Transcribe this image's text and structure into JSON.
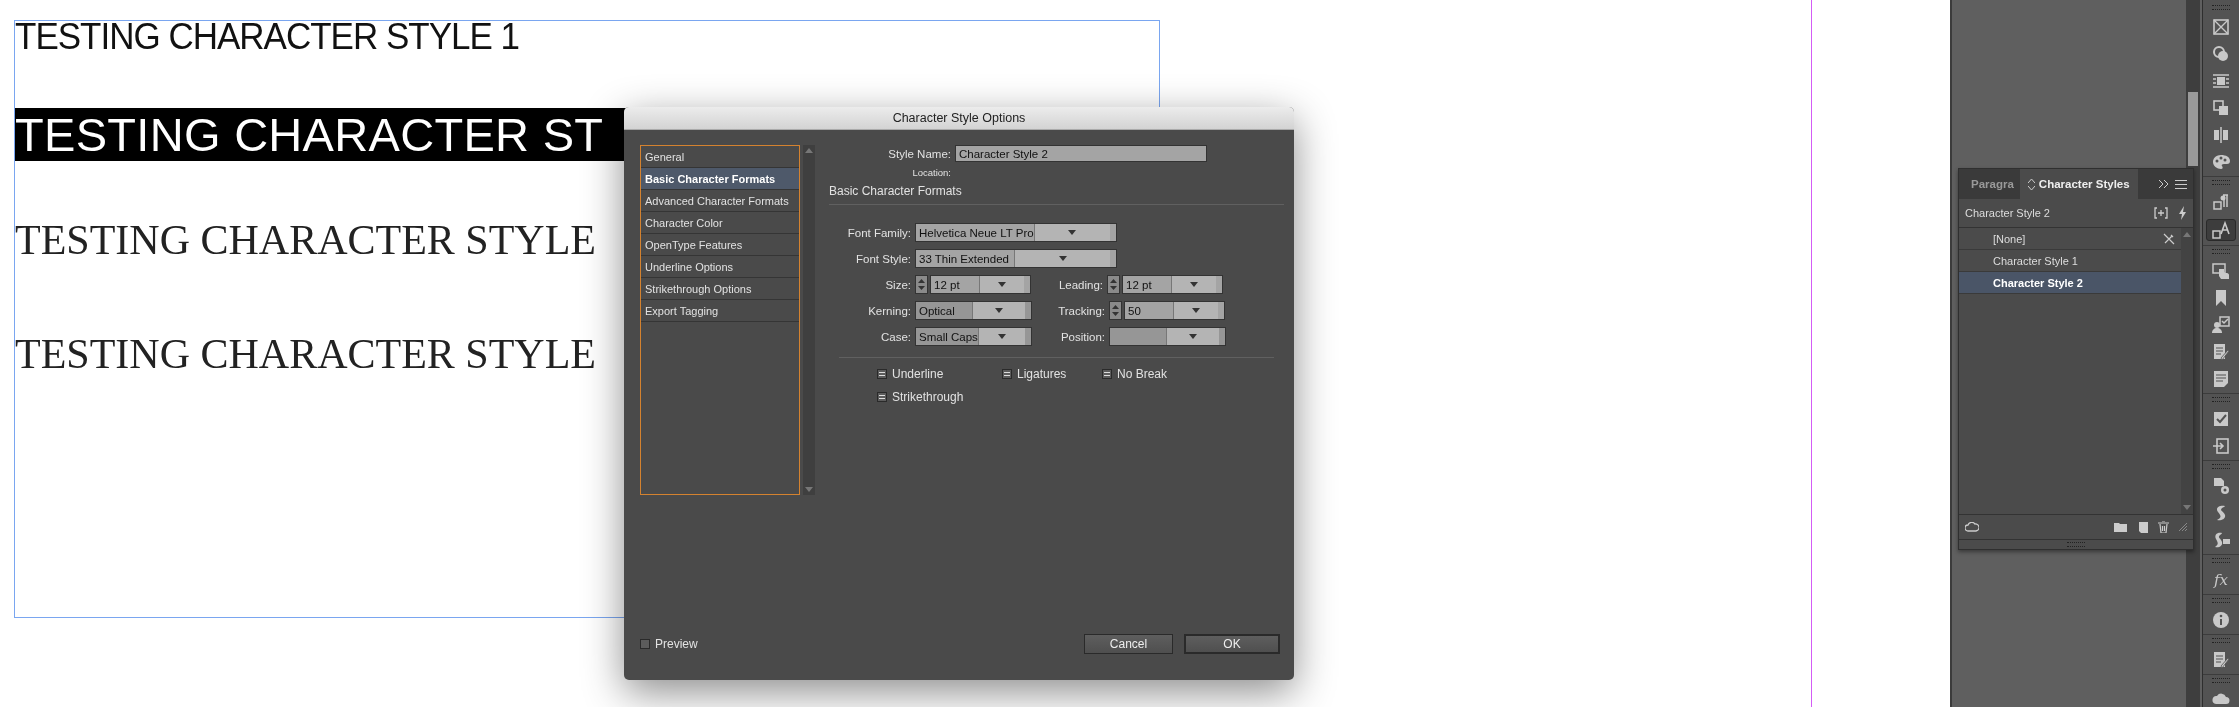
{
  "canvas": {
    "lines": [
      {
        "text": "TESTING CHARACTER STYLE 1",
        "kind": "thin"
      },
      {
        "text": "TESTING CHARACTER ST",
        "kind": "inverse"
      },
      {
        "text": "TESTING CHARACTER STYLE",
        "kind": "serif"
      },
      {
        "text": "TESTING CHARACTER STYLE",
        "kind": "serif"
      }
    ]
  },
  "dialog": {
    "title": "Character Style Options",
    "categories": [
      {
        "label": "General",
        "selected": false
      },
      {
        "label": "Basic Character Formats",
        "selected": true
      },
      {
        "label": "Advanced Character Formats",
        "selected": false
      },
      {
        "label": "Character Color",
        "selected": false
      },
      {
        "label": "OpenType Features",
        "selected": false
      },
      {
        "label": "Underline Options",
        "selected": false
      },
      {
        "label": "Strikethrough Options",
        "selected": false
      },
      {
        "label": "Export Tagging",
        "selected": false
      }
    ],
    "style_name": {
      "label": "Style Name:",
      "value": "Character Style 2"
    },
    "location_label": "Location:",
    "section_title": "Basic Character Formats",
    "fields": [
      [
        {
          "label": "Font Family:",
          "value": "Helvetica Neue LT Pro",
          "kind": "combo"
        }
      ],
      [
        {
          "label": "Font Style:",
          "value": "33 Thin Extended",
          "kind": "combo"
        }
      ],
      [
        {
          "label": "Size:",
          "value": "12 pt",
          "kind": "spin"
        },
        {
          "label": "Leading:",
          "value": "12 pt",
          "kind": "spin"
        }
      ],
      [
        {
          "label": "Kerning:",
          "value": "Optical",
          "kind": "select"
        },
        {
          "label": "Tracking:",
          "value": "50",
          "kind": "spin"
        }
      ],
      [
        {
          "label": "Case:",
          "value": "Small Caps",
          "kind": "select"
        },
        {
          "label": "Position:",
          "kind": "select"
        }
      ]
    ],
    "options": [
      [
        {
          "label": "Underline",
          "ignored": true
        },
        {
          "label": "Ligatures",
          "ignored": true
        },
        {
          "label": "No Break",
          "ignored": true
        }
      ],
      [
        {
          "label": "Strikethrough",
          "ignored": true
        }
      ]
    ],
    "preview": {
      "label": "Preview",
      "checked": false
    },
    "buttons": [
      {
        "label": "Cancel",
        "kind": "normal"
      },
      {
        "label": "OK",
        "kind": "default"
      }
    ]
  },
  "panel": {
    "tabs": [
      {
        "label": "Paragra",
        "selected": false
      },
      {
        "label": "Character Styles",
        "selected": true
      }
    ],
    "current_style": "Character Style 2",
    "styles": [
      {
        "name": "[None]",
        "selected": false,
        "locked": true
      },
      {
        "name": "Character Style 1",
        "selected": false,
        "locked": false
      },
      {
        "name": "Character Style 2",
        "selected": true,
        "locked": false
      }
    ]
  },
  "toolbar": [
    [
      {
        "kind": "frame",
        "selected": false
      },
      {
        "kind": "circles",
        "selected": false
      },
      {
        "kind": "wrap",
        "selected": false
      },
      {
        "kind": "layers",
        "selected": false
      },
      {
        "kind": "align",
        "selected": false
      },
      {
        "kind": "palette",
        "selected": false
      }
    ],
    [
      {
        "kind": "paragraph",
        "selected": false
      },
      {
        "kind": "character",
        "selected": true
      }
    ],
    [
      {
        "kind": "pointer",
        "selected": false
      },
      {
        "kind": "bookmark",
        "selected": false
      },
      {
        "kind": "person",
        "selected": false
      },
      {
        "kind": "pencil",
        "selected": false
      },
      {
        "kind": "note",
        "selected": false
      }
    ],
    [
      {
        "kind": "checklist",
        "selected": false
      },
      {
        "kind": "export",
        "selected": false
      }
    ],
    [
      {
        "kind": "gear",
        "selected": false
      },
      {
        "kind": "script",
        "selected": false
      },
      {
        "kind": "scripttag",
        "selected": false
      }
    ],
    [
      {
        "kind": "text",
        "label": "fx",
        "selected": false
      }
    ],
    [
      {
        "kind": "info",
        "selected": false
      }
    ],
    [
      {
        "kind": "pencil",
        "selected": false
      }
    ],
    [
      {
        "kind": "cloud",
        "selected": false
      }
    ]
  ]
}
